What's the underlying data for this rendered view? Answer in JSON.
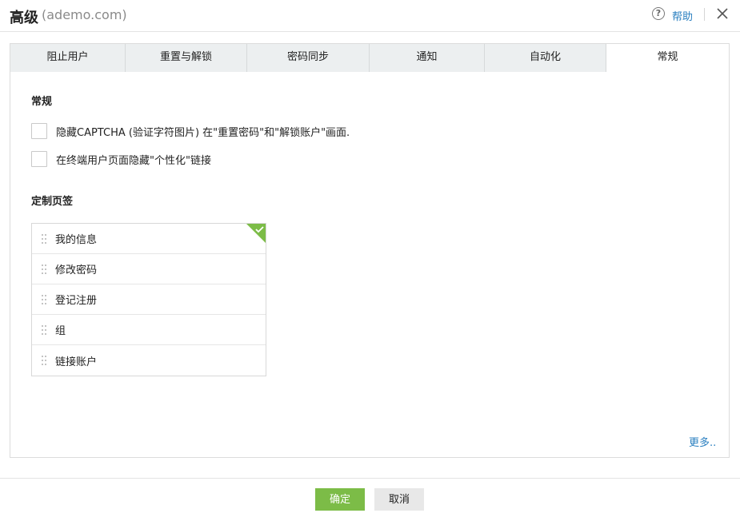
{
  "header": {
    "title": "高级",
    "subtitle": "(ademo.com)",
    "help_label": "帮助"
  },
  "tabs": [
    {
      "label": "阻止用户",
      "active": false
    },
    {
      "label": "重置与解锁",
      "active": false
    },
    {
      "label": "密码同步",
      "active": false
    },
    {
      "label": "通知",
      "active": false
    },
    {
      "label": "自动化",
      "active": false
    },
    {
      "label": "常规",
      "active": true
    }
  ],
  "general": {
    "section_title": "常规",
    "options": [
      {
        "label": "隐藏CAPTCHA (验证字符图片) 在\"重置密码\"和\"解锁账户\"画面.",
        "checked": false
      },
      {
        "label": "在终端用户页面隐藏\"个性化\"链接",
        "checked": false
      }
    ]
  },
  "custom_tabs": {
    "section_title": "定制页签",
    "items": [
      {
        "label": "我的信息"
      },
      {
        "label": "修改密码"
      },
      {
        "label": "登记注册"
      },
      {
        "label": "组"
      },
      {
        "label": "链接账户"
      }
    ],
    "more_label": "更多.."
  },
  "footer": {
    "ok_label": "确定",
    "cancel_label": "取消"
  },
  "colors": {
    "accent_green": "#7cbc47",
    "link_blue": "#2a7fc0"
  }
}
